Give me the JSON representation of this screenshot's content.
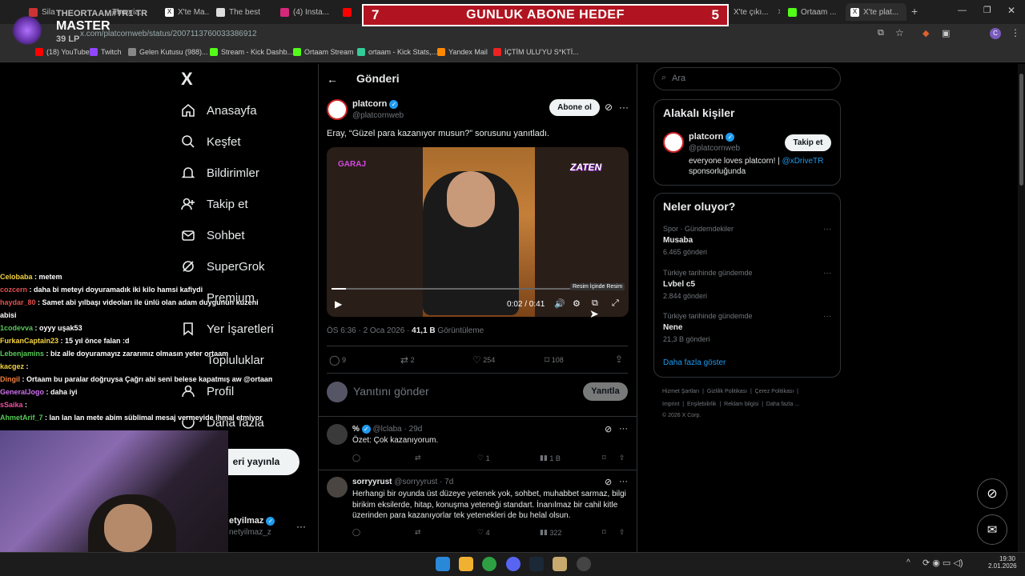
{
  "browser": {
    "tabs": [
      "Sila -",
      "Theoria...",
      "X'te Ma...",
      "The best",
      "(4) Insta...",
      "Th...",
      "X'te çıkı...",
      "Ortaam ...",
      "X'te plat..."
    ],
    "url": "x.com/platcornweb/status/2007113760033386912",
    "bookmarks": [
      "(18) YouTube",
      "Twitch",
      "Gelen Kutusu (988)...",
      "Stream - Kick Dashb...",
      "Ortaam Stream",
      "ortaam - Kick Stats,...",
      "Yandex Mail",
      "İÇTİM ULU'YU S*KTİ..."
    ]
  },
  "stream_overlay": {
    "goal_left": "7",
    "goal_title": "GUNLUK ABONE HEDEF",
    "goal_right": "5",
    "rank_name": "THEORTAAM#TR1 TR",
    "rank": "MASTER",
    "lp": "39 LP"
  },
  "left_nav": {
    "logo": "X",
    "items": [
      "Anasayfa",
      "Keşfet",
      "Bildirimler",
      "Takip et",
      "Sohbet",
      "SuperGrok",
      "Premium",
      "Yer İşaretleri",
      "Topluluklar",
      "Profil",
      "Daha fazla"
    ],
    "post_button": "eri yayınla",
    "account_name": "etyilmaz",
    "account_handle": "netyilmaz_z"
  },
  "post": {
    "header": "Gönderi",
    "author_name": "platcorn",
    "author_handle": "@platcornweb",
    "follow_label": "Abone ol",
    "text": "Eray, “Güzel para kazanıyor musun?” sorusunu yanıtladı.",
    "video_badge_left": "GARAJ",
    "video_badge_right": "ZATEN",
    "video_time": "0:02 / 0:41",
    "pip_tooltip": "Resim İçinde Resim",
    "timestamp": "ÖS 6:36 · 2 Oca 2026 · ",
    "views_value": "41,1 B",
    "views_label": " Görüntüleme",
    "replies": "9",
    "reposts": "2",
    "likes": "254",
    "bookmarks": "108",
    "reply_placeholder": "Yanıtını gönder",
    "reply_button": "Yanıtla"
  },
  "replies": [
    {
      "name": "%",
      "handle": "@lclaba · 29d",
      "text": "Özet: Çok kazanıyorum.",
      "reposts": "",
      "likes": "1",
      "views": "1 B"
    },
    {
      "name": "sorryyrust",
      "handle": "@sorryyrust · 7d",
      "text": "Herhangi bir oyunda üst düzeye yetenek yok, sohbet, muhabbet sarmaz, bilgi birikim eksilerde, hitap, konuşma yeteneği standart. İnanılmaz bir cahil kitle üzerinden para kazanıyorlar tek yetenekleri de bu helal olsun.",
      "reposts": "",
      "likes": "4",
      "views": "322"
    }
  ],
  "right": {
    "search_placeholder": "Ara",
    "related_title": "Alakalı kişiler",
    "related_name": "platcorn",
    "related_handle": "@platcornweb",
    "related_follow": "Takip et",
    "related_bio": "everyone loves platcorn! | ",
    "related_bio_link": "@xDriveTR",
    "related_bio_2": "sponsorluğunda",
    "trends_title": "Neler oluyor?",
    "trends": [
      {
        "context": "Spor · Gündemdekiler",
        "name": "Musaba",
        "count": "6.465 gönderi"
      },
      {
        "context": "Türkiye tarihinde gündemde",
        "name": "Lvbel c5",
        "count": "2.844 gönderi"
      },
      {
        "context": "Türkiye tarihinde gündemde",
        "name": "Nene",
        "count": "21,3 B gönderi"
      }
    ],
    "show_more": "Daha fazla göster",
    "footer_1": "Hizmet Şartları  |  Gizlilik Politikası  |  Çerez Politikası  |",
    "footer_2": "Imprint  |  Erişilebilirlik  |  Reklam bilgisi  |  Daha fazla ...",
    "footer_3": "© 2026 X Corp."
  },
  "chat": [
    {
      "user": "Celobaba",
      "msg": " : metem",
      "color": "#f5d442"
    },
    {
      "user": "cozcern",
      "msg": " : daha bi meteyi doyuramadık iki kilo hamsi kafiydi",
      "color": "#e05050"
    },
    {
      "user": "haydar_80",
      "msg": " : Samet abi yılbaşı videoları ile ünlü olan adam duygunun kuzeni",
      "color": "#e05050"
    },
    {
      "user": "",
      "msg": "abisi",
      "color": "#fff"
    },
    {
      "user": "1codevva",
      "msg": " : oyyy uşak53",
      "color": "#58c858"
    },
    {
      "user": "FurkanCaptain23",
      "msg": " : 15 yıl önce falan :d",
      "color": "#f5d442"
    },
    {
      "user": "Lebenjamins",
      "msg": " : biz alle doyuramayız zararımız olmasın yeter ortaam",
      "color": "#58c858"
    },
    {
      "user": "kacgez",
      "msg": " : ",
      "color": "#f5d442"
    },
    {
      "user": "Dingil",
      "msg": " : Ortaam bu paralar doğruysa Çağrı abi seni belese kapatmış aw @ortaam",
      "color": "#f08040"
    },
    {
      "user": "GeneralJogo",
      "msg": " : daha iyi",
      "color": "#d070f0"
    },
    {
      "user": "sSaika",
      "msg": " : ",
      "color": "#f050a0"
    },
    {
      "user": "AhmetArif_7",
      "msg": " : lan lan lan mete abim süblimal mesaj vermeyide ihmal etmiyor",
      "color": "#58c858"
    }
  ],
  "taskbar": {
    "time": "19:30",
    "date": "2.01.2026"
  },
  "colors": {
    "accent": "#1d9bf0",
    "banner": "#b11420"
  }
}
